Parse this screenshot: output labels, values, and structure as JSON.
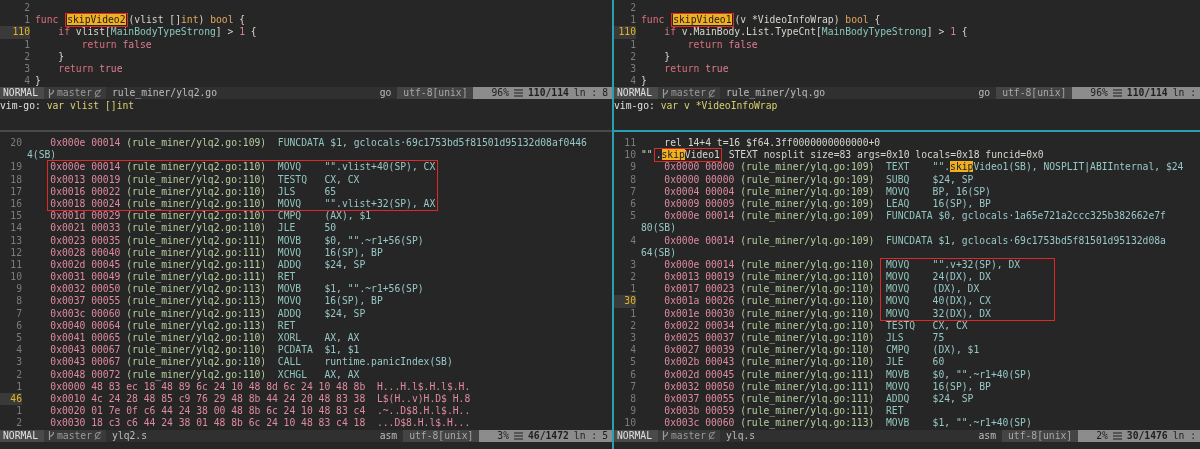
{
  "top_left": {
    "rows": [
      {
        "kind": "code",
        "num": "2",
        "current": false
      },
      {
        "kind": "code",
        "num": "1",
        "current": false,
        "segs": [
          {
            "text": "func ",
            "kind": "kw"
          },
          {
            "kind": "box",
            "parts": [
              {
                "text": "skipVideo2",
                "kind": "hl"
              }
            ]
          },
          {
            "text": "(vlist []",
            "kind": "plain"
          },
          {
            "text": "int",
            "kind": "type"
          },
          {
            "text": ") ",
            "kind": "plain"
          },
          {
            "text": "bool",
            "kind": "type"
          },
          {
            "text": " {",
            "kind": "plain"
          }
        ]
      },
      {
        "kind": "code",
        "num": "110",
        "current": true,
        "segs": [
          {
            "text": "    if ",
            "kind": "kw"
          },
          {
            "text": "vlist[",
            "kind": "plain"
          },
          {
            "text": "MainBodyTypeStrong",
            "kind": "const"
          },
          {
            "text": "] > ",
            "kind": "plain"
          },
          {
            "text": "1",
            "kind": "num"
          },
          {
            "text": " {",
            "kind": "plain"
          }
        ]
      },
      {
        "kind": "code",
        "num": "1",
        "current": false,
        "segs": [
          {
            "text": "        return ",
            "kind": "kw"
          },
          {
            "text": "false",
            "kind": "num"
          }
        ]
      },
      {
        "kind": "code",
        "num": "2",
        "current": false,
        "segs": [
          {
            "text": "    }",
            "kind": "plain"
          }
        ]
      },
      {
        "kind": "code",
        "num": "3",
        "current": false,
        "segs": [
          {
            "text": "    return ",
            "kind": "kw"
          },
          {
            "text": "true",
            "kind": "num"
          }
        ]
      },
      {
        "kind": "code",
        "num": "4",
        "current": false,
        "segs": [
          {
            "text": "}",
            "kind": "plain"
          }
        ]
      }
    ],
    "status": {
      "mode": "NORMAL",
      "branch": "master",
      "file": "rule_miner/ylq2.go",
      "filetype": "go",
      "encoding": "utf-8[unix]",
      "percent": "96%",
      "position": "110/114",
      "column_label": "ln :",
      "column": "8"
    },
    "command": {
      "label": "vim-go:",
      "value": "var vlist []int"
    }
  },
  "top_right": {
    "rows": [
      {
        "kind": "code",
        "num": "2",
        "current": false
      },
      {
        "kind": "code",
        "num": "1",
        "current": false,
        "segs": [
          {
            "text": "func ",
            "kind": "kw"
          },
          {
            "kind": "box",
            "parts": [
              {
                "text": "skipVideo1",
                "kind": "hl"
              }
            ]
          },
          {
            "text": "(v *VideoInfoWrap) ",
            "kind": "plain"
          },
          {
            "text": "bool",
            "kind": "type"
          },
          {
            "text": " {",
            "kind": "plain"
          }
        ]
      },
      {
        "kind": "code",
        "num": "110",
        "current": true,
        "segs": [
          {
            "text": "    if ",
            "kind": "kw"
          },
          {
            "text": "v.MainBody.List.TypeCnt[",
            "kind": "plain"
          },
          {
            "text": "MainBodyTypeStrong",
            "kind": "const"
          },
          {
            "text": "] > ",
            "kind": "plain"
          },
          {
            "text": "1",
            "kind": "num"
          },
          {
            "text": " {",
            "kind": "plain"
          }
        ]
      },
      {
        "kind": "code",
        "num": "1",
        "current": false,
        "segs": [
          {
            "text": "        return ",
            "kind": "kw"
          },
          {
            "text": "false",
            "kind": "num"
          }
        ]
      },
      {
        "kind": "code",
        "num": "2",
        "current": false,
        "segs": [
          {
            "text": "    }",
            "kind": "plain"
          }
        ]
      },
      {
        "kind": "code",
        "num": "3",
        "current": false,
        "segs": [
          {
            "text": "    return ",
            "kind": "kw"
          },
          {
            "text": "true",
            "kind": "num"
          }
        ]
      },
      {
        "kind": "code",
        "num": "4",
        "current": false,
        "segs": [
          {
            "text": "}",
            "kind": "plain"
          }
        ]
      }
    ],
    "status": {
      "mode": "NORMAL",
      "branch": "master",
      "file": "rule_miner/ylq.go",
      "filetype": "go",
      "encoding": "utf-8[unix]",
      "percent": "96%",
      "position": "110/114",
      "column_label": "ln :"
    },
    "command": {
      "label": "vim-go:",
      "value": "var v *VideoInfoWrap"
    }
  },
  "bottom_left": {
    "rows": [
      {
        "kind": "asm",
        "num": "20",
        "current": false,
        "addr": "0x000e 00014",
        "src": "(rule_miner/ylq2.go:109)",
        "op": "FUNCDATA",
        "args": "$1, gclocals·69c1753bd5f81501d95132d08af0446"
      },
      {
        "kind": "wrap",
        "text": "4(SB)"
      },
      {
        "kind": "asm",
        "num": "19",
        "current": false,
        "boxed": true,
        "addr": "0x000e 00014",
        "src": "(rule_miner/ylq2.go:110)",
        "op": "MOVQ",
        "args": "\"\".vlist+40(SP), CX"
      },
      {
        "kind": "asm",
        "num": "18",
        "current": false,
        "boxed": true,
        "addr": "0x0013 00019",
        "src": "(rule_miner/ylq2.go:110)",
        "op": "TESTQ",
        "args": "CX, CX"
      },
      {
        "kind": "asm",
        "num": "17",
        "current": false,
        "boxed": true,
        "addr": "0x0016 00022",
        "src": "(rule_miner/ylq2.go:110)",
        "op": "JLS",
        "args": "65"
      },
      {
        "kind": "asm",
        "num": "16",
        "current": false,
        "boxed": true,
        "addr": "0x0018 00024",
        "src": "(rule_miner/ylq2.go:110)",
        "op": "MOVQ",
        "args": "\"\".vlist+32(SP), AX"
      },
      {
        "kind": "asm",
        "num": "15",
        "current": false,
        "addr": "0x001d 00029",
        "src": "(rule_miner/ylq2.go:110)",
        "op": "CMPQ",
        "args": "(AX), $1"
      },
      {
        "kind": "asm",
        "num": "14",
        "current": false,
        "addr": "0x0021 00033",
        "src": "(rule_miner/ylq2.go:110)",
        "op": "JLE",
        "args": "50"
      },
      {
        "kind": "asm",
        "num": "13",
        "current": false,
        "addr": "0x0023 00035",
        "src": "(rule_miner/ylq2.go:111)",
        "op": "MOVB",
        "args": "$0, \"\".~r1+56(SP)"
      },
      {
        "kind": "asm",
        "num": "12",
        "current": false,
        "addr": "0x0028 00040",
        "src": "(rule_miner/ylq2.go:111)",
        "op": "MOVQ",
        "args": "16(SP), BP"
      },
      {
        "kind": "asm",
        "num": "11",
        "current": false,
        "addr": "0x002d 00045",
        "src": "(rule_miner/ylq2.go:111)",
        "op": "ADDQ",
        "args": "$24, SP"
      },
      {
        "kind": "asm",
        "num": "10",
        "current": false,
        "addr": "0x0031 00049",
        "src": "(rule_miner/ylq2.go:111)",
        "op": "RET"
      },
      {
        "kind": "asm",
        "num": "9",
        "current": false,
        "addr": "0x0032 00050",
        "src": "(rule_miner/ylq2.go:113)",
        "op": "MOVB",
        "args": "$1, \"\".~r1+56(SP)"
      },
      {
        "kind": "asm",
        "num": "8",
        "current": false,
        "addr": "0x0037 00055",
        "src": "(rule_miner/ylq2.go:113)",
        "op": "MOVQ",
        "args": "16(SP), BP"
      },
      {
        "kind": "asm",
        "num": "7",
        "current": false,
        "addr": "0x003c 00060",
        "src": "(rule_miner/ylq2.go:113)",
        "op": "ADDQ",
        "args": "$24, SP"
      },
      {
        "kind": "asm",
        "num": "6",
        "current": false,
        "addr": "0x0040 00064",
        "src": "(rule_miner/ylq2.go:113)",
        "op": "RET"
      },
      {
        "kind": "asm",
        "num": "5",
        "current": false,
        "addr": "0x0041 00065",
        "src": "(rule_miner/ylq2.go:110)",
        "op": "XORL",
        "args": "AX, AX"
      },
      {
        "kind": "asm",
        "num": "4",
        "current": false,
        "addr": "0x0043 00067",
        "src": "(rule_miner/ylq2.go:110)",
        "op": "PCDATA",
        "args": "$1, $1"
      },
      {
        "kind": "asm",
        "num": "3",
        "current": false,
        "addr": "0x0043 00067",
        "src": "(rule_miner/ylq2.go:110)",
        "op": "CALL",
        "args": "runtime.panicIndex(SB)"
      },
      {
        "kind": "asm",
        "num": "2",
        "current": false,
        "addr": "0x0048 00072",
        "src": "(rule_miner/ylq2.go:110)",
        "op": "XCHGL",
        "args": "AX, AX"
      },
      {
        "kind": "hex",
        "num": "1",
        "current": false,
        "addr": "0x0000",
        "bytes": "48 83 ec 18 48 89 6c 24 10 48 8d 6c 24 10 48 8b",
        "ascii": "H...H.l$.H.l$.H."
      },
      {
        "kind": "hex",
        "num": "46",
        "current": true,
        "addr": "0x0010",
        "bytes": "4c 24 28 48 85 c9 76 29 48 8b 44 24 20 48 83 38",
        "ascii": "L$(H..v)H.D$ H.8"
      },
      {
        "kind": "hex",
        "num": "1",
        "current": false,
        "addr": "0x0020",
        "bytes": "01 7e 0f c6 44 24 38 00 48 8b 6c 24 10 48 83 c4",
        "ascii": ".~..D$8.H.l$.H.."
      },
      {
        "kind": "hex",
        "num": "2",
        "current": false,
        "addr": "0x0030",
        "bytes": "18 c3 c6 44 24 38 01 48 8b 6c 24 10 48 83 c4 18",
        "ascii": "...D$8.H.l$.H..."
      }
    ],
    "status": {
      "mode": "NORMAL",
      "branch": "master",
      "file": "ylq2.s",
      "filetype": "asm",
      "encoding": "utf-8[unix]",
      "percent": "3%",
      "position": "46/1472",
      "column_label": "ln :",
      "column": "5"
    }
  },
  "bottom_right": {
    "rows": [
      {
        "kind": "code",
        "num": "11",
        "current": false,
        "segs": [
          {
            "text": "    rel 14+4 t=16 $f64.3ff0000000000000+0",
            "kind": "plain"
          }
        ]
      },
      {
        "kind": "code",
        "num": "10",
        "current": false,
        "segs": [
          {
            "text": "\"\"",
            "kind": "plain"
          },
          {
            "kind": "box",
            "parts": [
              {
                "text": ".",
                "kind": "plain"
              },
              {
                "text": "skip",
                "kind": "hl"
              },
              {
                "text": "Video1",
                "kind": "plain"
              }
            ]
          },
          {
            "text": " STEXT nosplit size=83 args=0x10 locals=0x18 funcid=0x0",
            "kind": "plain"
          }
        ]
      },
      {
        "kind": "asm",
        "num": "9",
        "current": false,
        "addr": "0x0000 00000",
        "src": "(rule_miner/ylq.go:109)",
        "op": "TEXT",
        "args": [
          {
            "text": "\"\".",
            "kind": "reg"
          },
          {
            "text": "skip",
            "kind": "hl"
          },
          {
            "text": "Video1(SB), NOSPLIT|ABIInternal, $24",
            "kind": "reg"
          }
        ]
      },
      {
        "kind": "asm",
        "num": "8",
        "current": false,
        "addr": "0x0000 00000",
        "src": "(rule_miner/ylq.go:109)",
        "op": "SUBQ",
        "args": "$24, SP"
      },
      {
        "kind": "asm",
        "num": "7",
        "current": false,
        "addr": "0x0004 00004",
        "src": "(rule_miner/ylq.go:109)",
        "op": "MOVQ",
        "args": "BP, 16(SP)"
      },
      {
        "kind": "asm",
        "num": "6",
        "current": false,
        "addr": "0x0009 00009",
        "src": "(rule_miner/ylq.go:109)",
        "op": "LEAQ",
        "args": "16(SP), BP"
      },
      {
        "kind": "asm",
        "num": "5",
        "current": false,
        "addr": "0x000e 00014",
        "src": "(rule_miner/ylq.go:109)",
        "op": "FUNCDATA",
        "args": "$0, gclocals·1a65e721a2ccc325b382662e7f"
      },
      {
        "kind": "wrap",
        "text": "80(SB)"
      },
      {
        "kind": "asm",
        "num": "4",
        "current": false,
        "addr": "0x000e 00014",
        "src": "(rule_miner/ylq.go:109)",
        "op": "FUNCDATA",
        "args": "$1, gclocals·69c1753bd5f81501d95132d08a"
      },
      {
        "kind": "wrap",
        "text": "64(SB)"
      },
      {
        "kind": "asm",
        "num": "3",
        "current": false,
        "boxed": true,
        "addr": "0x000e 00014",
        "src": "(rule_miner/ylq.go:110)",
        "op": "MOVQ",
        "args": "\"\".v+32(SP), DX"
      },
      {
        "kind": "asm",
        "num": "2",
        "current": false,
        "boxed": true,
        "addr": "0x0013 00019",
        "src": "(rule_miner/ylq.go:110)",
        "op": "MOVQ",
        "args": "24(DX), DX"
      },
      {
        "kind": "asm",
        "num": "1",
        "current": false,
        "boxed": true,
        "addr": "0x0017 00023",
        "src": "(rule_miner/ylq.go:110)",
        "op": "MOVQ",
        "args": "(DX), DX"
      },
      {
        "kind": "asm",
        "num": "30",
        "current": true,
        "boxed": true,
        "addr": "0x001a 00026",
        "src": "(rule_miner/ylq.go:110)",
        "op": "MOVQ",
        "args": "40(DX), CX"
      },
      {
        "kind": "asm",
        "num": "1",
        "current": false,
        "boxed": true,
        "addr": "0x001e 00030",
        "src": "(rule_miner/ylq.go:110)",
        "op": "MOVQ",
        "args": "32(DX), DX"
      },
      {
        "kind": "asm",
        "num": "2",
        "current": false,
        "addr": "0x0022 00034",
        "src": "(rule_miner/ylq.go:110)",
        "op": "TESTQ",
        "args": "CX, CX"
      },
      {
        "kind": "asm",
        "num": "3",
        "current": false,
        "addr": "0x0025 00037",
        "src": "(rule_miner/ylq.go:110)",
        "op": "JLS",
        "args": "75"
      },
      {
        "kind": "asm",
        "num": "4",
        "current": false,
        "addr": "0x0027 00039",
        "src": "(rule_miner/ylq.go:110)",
        "op": "CMPQ",
        "args": "(DX), $1"
      },
      {
        "kind": "asm",
        "num": "5",
        "current": false,
        "addr": "0x002b 00043",
        "src": "(rule_miner/ylq.go:110)",
        "op": "JLE",
        "args": "60"
      },
      {
        "kind": "asm",
        "num": "6",
        "current": false,
        "addr": "0x002d 00045",
        "src": "(rule_miner/ylq.go:111)",
        "op": "MOVB",
        "args": "$0, \"\".~r1+40(SP)"
      },
      {
        "kind": "asm",
        "num": "7",
        "current": false,
        "addr": "0x0032 00050",
        "src": "(rule_miner/ylq.go:111)",
        "op": "MOVQ",
        "args": "16(SP), BP"
      },
      {
        "kind": "asm",
        "num": "8",
        "current": false,
        "addr": "0x0037 00055",
        "src": "(rule_miner/ylq.go:111)",
        "op": "ADDQ",
        "args": "$24, SP"
      },
      {
        "kind": "asm",
        "num": "9",
        "current": false,
        "addr": "0x003b 00059",
        "src": "(rule_miner/ylq.go:111)",
        "op": "RET"
      },
      {
        "kind": "asm",
        "num": "10",
        "current": false,
        "addr": "0x003c 00060",
        "src": "(rule_miner/ylq.go:113)",
        "op": "MOVB",
        "args": "$1, \"\".~r1+40(SP)"
      }
    ],
    "status": {
      "mode": "NORMAL",
      "branch": "master",
      "file": "ylq.s",
      "filetype": "asm",
      "encoding": "utf-8[unix]",
      "percent": "2%",
      "position": "30/1476",
      "column_label": "ln :"
    }
  }
}
